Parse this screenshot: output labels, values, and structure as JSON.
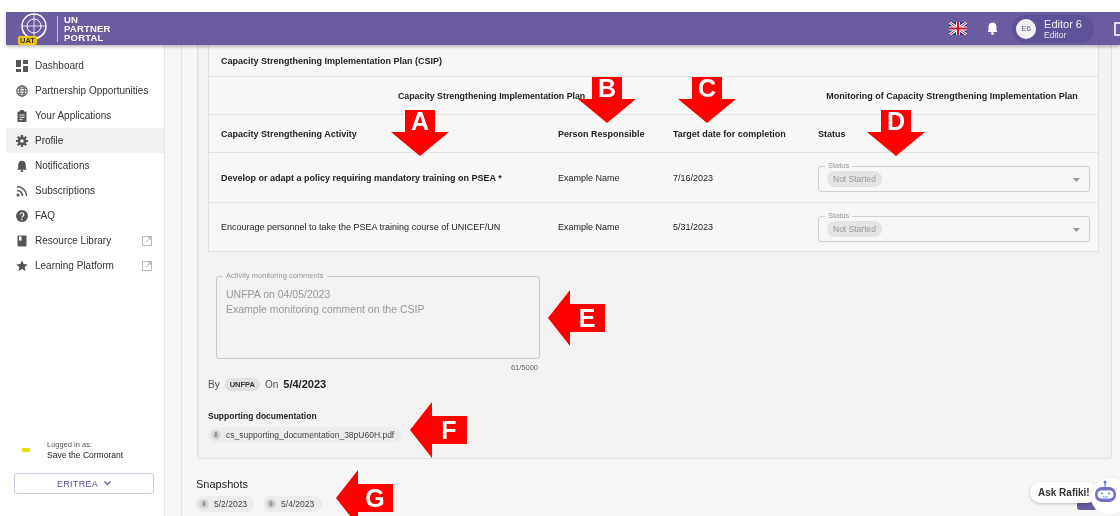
{
  "header": {
    "badge": "UAT",
    "title": [
      "UN",
      "PARTNER",
      "PORTAL"
    ],
    "user": {
      "initials": "E6",
      "name": "Editor 6",
      "role": "Editor"
    }
  },
  "sidebar": {
    "items": [
      {
        "label": "Dashboard",
        "selected": false,
        "external": false
      },
      {
        "label": "Partnership Opportunities",
        "selected": false,
        "external": false
      },
      {
        "label": "Your Applications",
        "selected": false,
        "external": false
      },
      {
        "label": "Profile",
        "selected": true,
        "external": false
      },
      {
        "label": "Notifications",
        "selected": false,
        "external": false
      },
      {
        "label": "Subscriptions",
        "selected": false,
        "external": false
      },
      {
        "label": "FAQ",
        "selected": false,
        "external": false
      },
      {
        "label": "Resource Library",
        "selected": false,
        "external": true
      },
      {
        "label": "Learning Platform",
        "selected": false,
        "external": true
      }
    ],
    "logged_in_label": "Logged in as:",
    "organization": "Save the Cormorant",
    "country_button": "ERITREA"
  },
  "csip": {
    "title": "Capacity Strengthening Implementation Plan (CSIP)",
    "group_headers": [
      "Capacity Strengthening Implementation Plan",
      "Monitoring of Capacity Strengthening Implementation Plan"
    ],
    "columns": [
      "Capacity Strengthening Activity",
      "Person Responsible",
      "Target date for completion",
      "Status"
    ],
    "rows": [
      {
        "activity": "Develop or adapt a policy requiring mandatory training on PSEA *",
        "bold": true,
        "person": "Example Name",
        "target_date": "7/16/2023",
        "status": {
          "label": "Status",
          "value": "Not Started",
          "disabled": true
        }
      },
      {
        "activity": "Encourage personnel to take the PSEA training course of UNICEF/UN",
        "bold": false,
        "person": "Example Name",
        "target_date": "5/31/2023",
        "status": {
          "label": "Status",
          "value": "Not Started",
          "disabled": true
        }
      }
    ],
    "comments": {
      "label": "Activity monitoring comments",
      "value": "UNFPA on 04/05/2023\nExample monitoring comment on the CSIP",
      "counter": "61/5000",
      "disabled": true
    },
    "by_label": "By",
    "by_agency": "UNFPA",
    "on_label": "On",
    "on_date": "5/4/2023",
    "supporting_title": "Supporting documentation",
    "supporting_files": [
      "cs_supporting_documentation_38pU60H.pdf"
    ]
  },
  "snapshots": {
    "title": "Snapshots",
    "items": [
      "5/2/2023",
      "5/4/2023"
    ]
  },
  "chat": {
    "label": "Ask Rafiki!"
  },
  "annotations": [
    {
      "label": "A",
      "kind": "down"
    },
    {
      "label": "B",
      "kind": "down"
    },
    {
      "label": "C",
      "kind": "down"
    },
    {
      "label": "D",
      "kind": "down"
    },
    {
      "label": "E",
      "kind": "left"
    },
    {
      "label": "F",
      "kind": "left"
    },
    {
      "label": "G",
      "kind": "left"
    }
  ]
}
